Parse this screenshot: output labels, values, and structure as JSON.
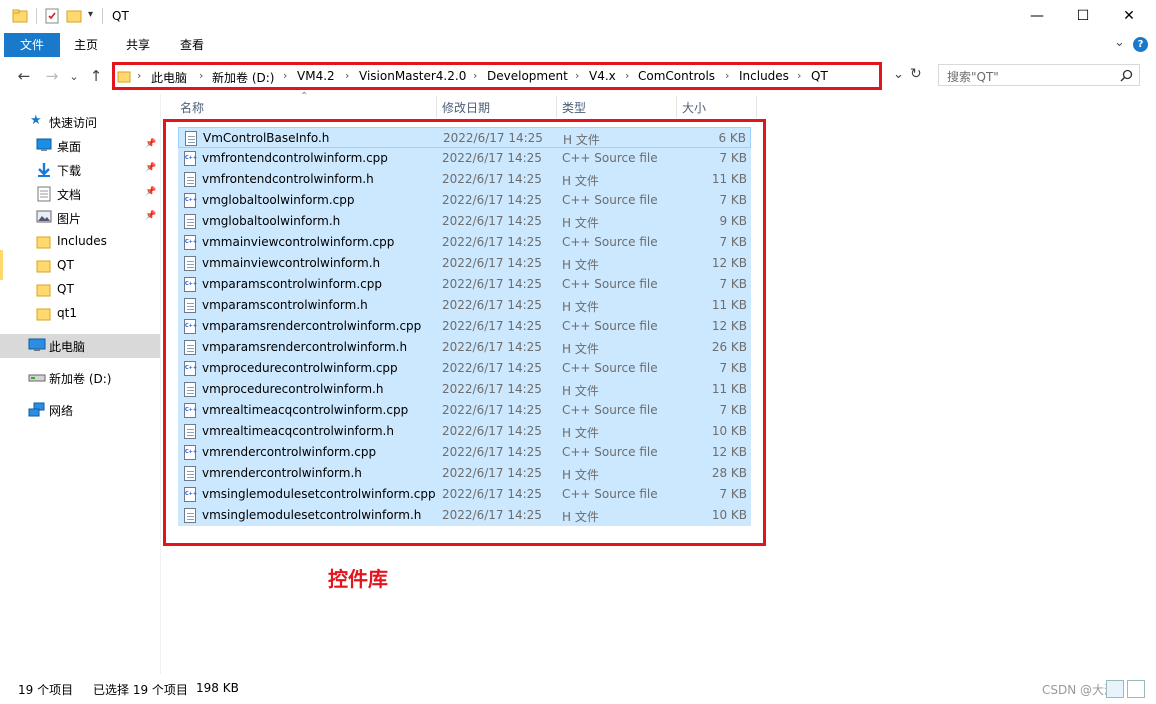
{
  "window": {
    "title": "QT",
    "controls": {
      "minimize": "—",
      "maximize": "☐",
      "close": "✕"
    }
  },
  "ribbon": {
    "tabs": [
      "文件",
      "主页",
      "共享",
      "查看"
    ],
    "expand": "⌄",
    "help": "?"
  },
  "nav": {
    "back": "←",
    "forward": "→",
    "recent": "⌄",
    "up": "↑",
    "dropdown": "⌄",
    "refresh": "↻"
  },
  "breadcrumb": [
    "此电脑",
    "新加卷 (D:)",
    "VM4.2",
    "VisionMaster4.2.0",
    "Development",
    "V4.x",
    "ComControls",
    "Includes",
    "QT"
  ],
  "breadcrumb_sep": "›",
  "search": {
    "placeholder": "搜索\"QT\"",
    "icon": "search-icon"
  },
  "sidebar": {
    "quick_access": "快速访问",
    "items": [
      {
        "label": "桌面",
        "icon": "desktop-icon",
        "pinned": true
      },
      {
        "label": "下载",
        "icon": "download-icon",
        "pinned": true
      },
      {
        "label": "文档",
        "icon": "document-icon",
        "pinned": true
      },
      {
        "label": "图片",
        "icon": "picture-icon",
        "pinned": true
      },
      {
        "label": "Includes",
        "icon": "folder-icon",
        "pinned": false
      },
      {
        "label": "QT",
        "icon": "folder-icon",
        "pinned": false
      },
      {
        "label": "QT",
        "icon": "folder-icon",
        "pinned": false
      },
      {
        "label": "qt1",
        "icon": "folder-icon",
        "pinned": false
      }
    ],
    "this_pc": "此电脑",
    "drive": "新加卷 (D:)",
    "network": "网络"
  },
  "columns": {
    "name": "名称",
    "date": "修改日期",
    "type": "类型",
    "size": "大小"
  },
  "files": [
    {
      "name": "VmControlBaseInfo.h",
      "date": "2022/6/17 14:25",
      "type": "H 文件",
      "size": "6 KB",
      "kind": "h"
    },
    {
      "name": "vmfrontendcontrolwinform.cpp",
      "date": "2022/6/17 14:25",
      "type": "C++ Source file",
      "size": "7 KB",
      "kind": "cpp"
    },
    {
      "name": "vmfrontendcontrolwinform.h",
      "date": "2022/6/17 14:25",
      "type": "H 文件",
      "size": "11 KB",
      "kind": "h"
    },
    {
      "name": "vmglobaltoolwinform.cpp",
      "date": "2022/6/17 14:25",
      "type": "C++ Source file",
      "size": "7 KB",
      "kind": "cpp"
    },
    {
      "name": "vmglobaltoolwinform.h",
      "date": "2022/6/17 14:25",
      "type": "H 文件",
      "size": "9 KB",
      "kind": "h"
    },
    {
      "name": "vmmainviewcontrolwinform.cpp",
      "date": "2022/6/17 14:25",
      "type": "C++ Source file",
      "size": "7 KB",
      "kind": "cpp"
    },
    {
      "name": "vmmainviewcontrolwinform.h",
      "date": "2022/6/17 14:25",
      "type": "H 文件",
      "size": "12 KB",
      "kind": "h"
    },
    {
      "name": "vmparamscontrolwinform.cpp",
      "date": "2022/6/17 14:25",
      "type": "C++ Source file",
      "size": "7 KB",
      "kind": "cpp"
    },
    {
      "name": "vmparamscontrolwinform.h",
      "date": "2022/6/17 14:25",
      "type": "H 文件",
      "size": "11 KB",
      "kind": "h"
    },
    {
      "name": "vmparamsrendercontrolwinform.cpp",
      "date": "2022/6/17 14:25",
      "type": "C++ Source file",
      "size": "12 KB",
      "kind": "cpp"
    },
    {
      "name": "vmparamsrendercontrolwinform.h",
      "date": "2022/6/17 14:25",
      "type": "H 文件",
      "size": "26 KB",
      "kind": "h"
    },
    {
      "name": "vmprocedurecontrolwinform.cpp",
      "date": "2022/6/17 14:25",
      "type": "C++ Source file",
      "size": "7 KB",
      "kind": "cpp"
    },
    {
      "name": "vmprocedurecontrolwinform.h",
      "date": "2022/6/17 14:25",
      "type": "H 文件",
      "size": "11 KB",
      "kind": "h"
    },
    {
      "name": "vmrealtimeacqcontrolwinform.cpp",
      "date": "2022/6/17 14:25",
      "type": "C++ Source file",
      "size": "7 KB",
      "kind": "cpp"
    },
    {
      "name": "vmrealtimeacqcontrolwinform.h",
      "date": "2022/6/17 14:25",
      "type": "H 文件",
      "size": "10 KB",
      "kind": "h"
    },
    {
      "name": "vmrendercontrolwinform.cpp",
      "date": "2022/6/17 14:25",
      "type": "C++ Source file",
      "size": "12 KB",
      "kind": "cpp"
    },
    {
      "name": "vmrendercontrolwinform.h",
      "date": "2022/6/17 14:25",
      "type": "H 文件",
      "size": "28 KB",
      "kind": "h"
    },
    {
      "name": "vmsinglemodulesetcontrolwinform.cpp",
      "date": "2022/6/17 14:25",
      "type": "C++ Source file",
      "size": "7 KB",
      "kind": "cpp"
    },
    {
      "name": "vmsinglemodulesetcontrolwinform.h",
      "date": "2022/6/17 14:25",
      "type": "H 文件",
      "size": "10 KB",
      "kind": "h"
    }
  ],
  "annotation": "控件库",
  "status": {
    "count": "19 个项目",
    "selected": "已选择 19 个项目",
    "size": "198 KB"
  },
  "watermark": "CSDN @大海",
  "colors": {
    "accent": "#1979ca",
    "selection": "#cce8ff",
    "highlight_box": "#e3151c"
  }
}
